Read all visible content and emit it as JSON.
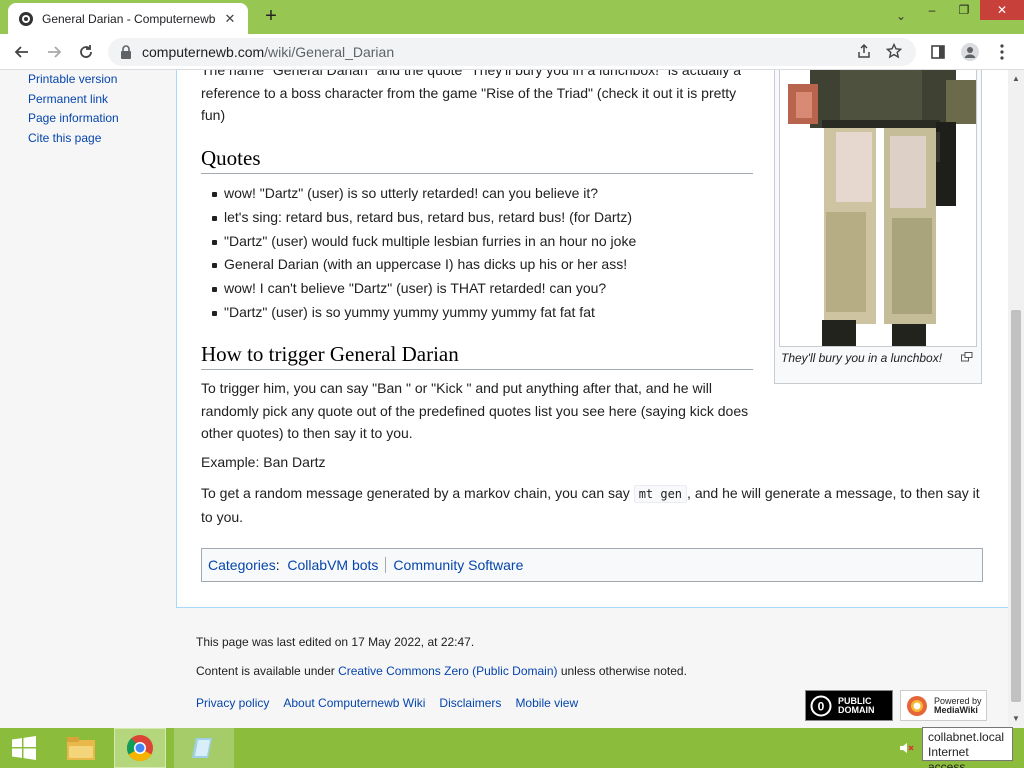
{
  "browser": {
    "tab_title": "General Darian - Computernewb",
    "url_host": "computernewb.com",
    "url_path": "/wiki/General_Darian"
  },
  "sidebar": {
    "items": [
      "Printable version",
      "Permanent link",
      "Page information",
      "Cite this page"
    ]
  },
  "article": {
    "intro_text": "The name \"General Darian\" and the quote \"They'll bury you in a lunchbox!\" is actually a reference to a boss character from the game \"Rise of the Triad\" (check it out it is pretty fun)",
    "quotes_heading": "Quotes",
    "quotes": [
      "wow! \"Dartz\" (user) is so utterly retarded! can you believe it?",
      "let's sing: retard bus, retard bus, retard bus, retard bus! (for Dartz)",
      "\"Dartz\" (user) would fuck multiple lesbian furries in an hour no joke",
      "General Darian (with an uppercase I) has dicks up his or her ass!",
      "wow! I can't believe \"Dartz\" (user) is THAT retarded! can you?",
      "\"Dartz\" (user) is so yummy yummy yummy yummy fat fat fat"
    ],
    "trigger_heading": "How to trigger General Darian",
    "trigger_text": "To trigger him, you can say \"Ban \" or \"Kick \" and put anything after that, and he will randomly pick any quote out of the predefined quotes list you see here (saying kick does other quotes) to then say it to you.",
    "example_text": "Example: Ban Dartz",
    "markov_before": "To get a random message generated by a markov chain, you can say ",
    "markov_code": "mt gen",
    "markov_after": ", and he will generate a message, to then say it to you.",
    "thumb_caption": "They'll bury you in a lunchbox!"
  },
  "categories": {
    "label": "Categories",
    "items": [
      "CollabVM bots",
      "Community Software"
    ]
  },
  "footer": {
    "last_edited": "This page was last edited on 17 May 2022, at 22:47.",
    "license_before": "Content is available under ",
    "license_link": "Creative Commons Zero (Public Domain)",
    "license_after": " unless otherwise noted.",
    "links": [
      "Privacy policy",
      "About Computernewb Wiki",
      "Disclaimers",
      "Mobile view"
    ],
    "badge_pd_line1": "PUBLIC",
    "badge_pd_line2": "DOMAIN",
    "badge_mw_line1": "Powered by",
    "badge_mw_line2": "MediaWiki"
  },
  "tray": {
    "network_name": "collabnet.local",
    "network_status": "Internet access"
  },
  "colors": {
    "tabstrip": "#98c653",
    "taskbar": "#8cbc3c",
    "link": "#0645ad"
  }
}
